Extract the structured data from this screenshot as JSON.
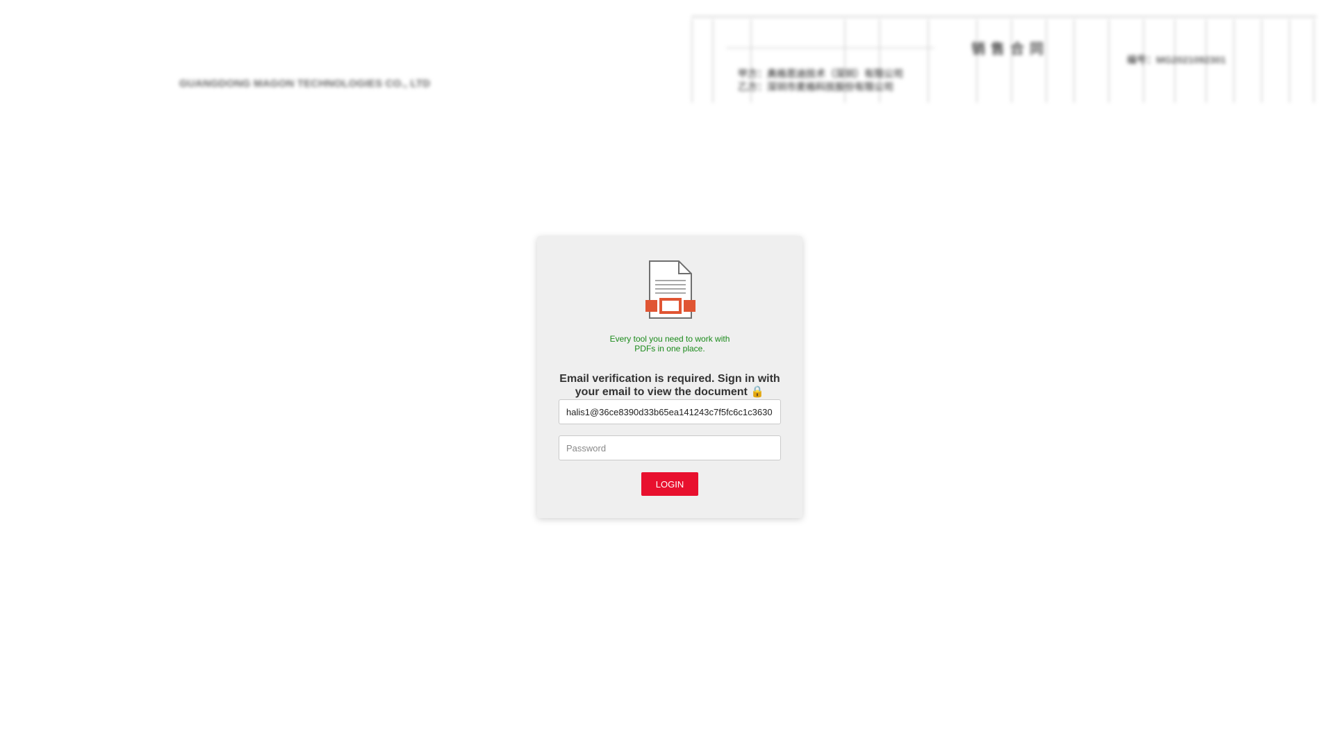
{
  "background_document": {
    "company_name": "GUANGDONG MAGON TECHNOLOGIES CO.,  LTD",
    "title": "销售合同",
    "contract_number": "编号：MG2021092301",
    "party_a": "甲方：奥格思迪技术（深圳）有限公司",
    "party_b": "乙方：深圳市麦格科技股份有限公司"
  },
  "login_card": {
    "icon": "pdf-document-icon",
    "tagline": "Every tool you need to work with PDFs in one place.",
    "heading": "Email verification is required. Sign in with your email to view the document 🔒",
    "email_value": "halis1@36ce8390d33b65ea141243c7f5fc6c1c3630",
    "password_placeholder": "Password",
    "login_label": "LOGIN"
  },
  "colors": {
    "tagline": "#1a8a1a",
    "login_button": "#e8102e",
    "icon_accent": "#e05533",
    "card_background": "#efefef"
  }
}
